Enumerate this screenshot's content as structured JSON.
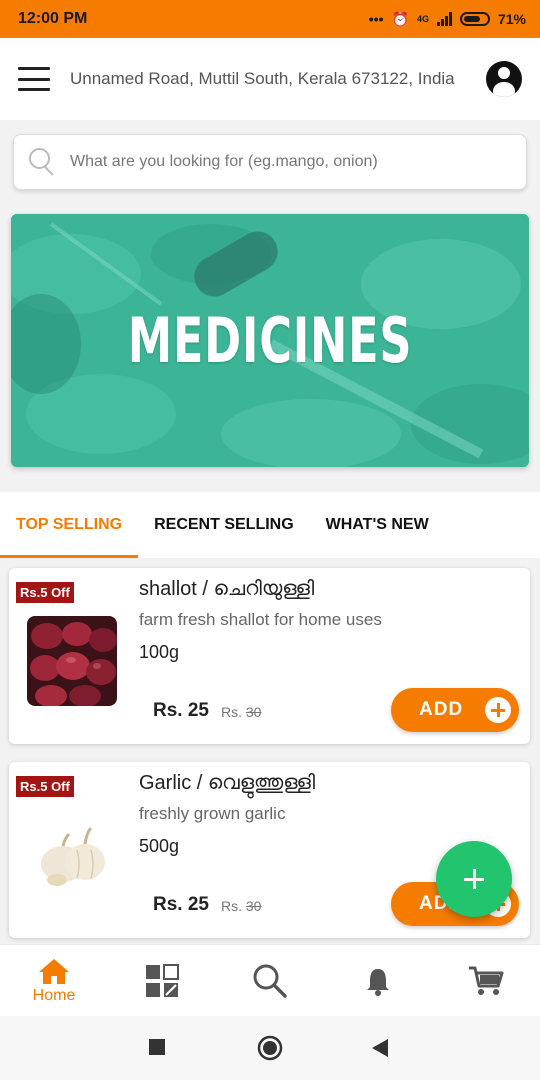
{
  "status_bar": {
    "time": "12:00 PM",
    "network": "4G",
    "battery": "71%"
  },
  "header": {
    "address": "Unnamed Road, Muttil South, Kerala 673122, India"
  },
  "search": {
    "placeholder": "What are you looking for (eg.mango, onion)"
  },
  "banner": {
    "title": "MEDICINES"
  },
  "tabs": [
    {
      "label": "TOP SELLING",
      "active": true
    },
    {
      "label": "RECENT SELLING",
      "active": false
    },
    {
      "label": "WHAT'S NEW",
      "active": false
    }
  ],
  "products": [
    {
      "badge": "Rs.5 Off",
      "name": "shallot  / ചെറിയുള്ളി",
      "description": "farm fresh shallot for home uses",
      "quantity": "100g",
      "price": "Rs. 25",
      "mrp_prefix": "Rs.",
      "mrp": "30",
      "add_label": "ADD"
    },
    {
      "badge": "Rs.5 Off",
      "name": "Garlic  / വെളുത്തുള്ളി",
      "description": "freshly grown garlic",
      "quantity": "500g",
      "price": "Rs. 25",
      "mrp_prefix": "Rs.",
      "mrp": "30",
      "add_label": "ADD"
    }
  ],
  "bottom_nav": {
    "home_label": "Home",
    "active_color": "#f57c00"
  },
  "colors": {
    "accent": "#f57c00",
    "fab": "#22c46e",
    "badge": "#a31515",
    "banner": "#3bb596"
  }
}
